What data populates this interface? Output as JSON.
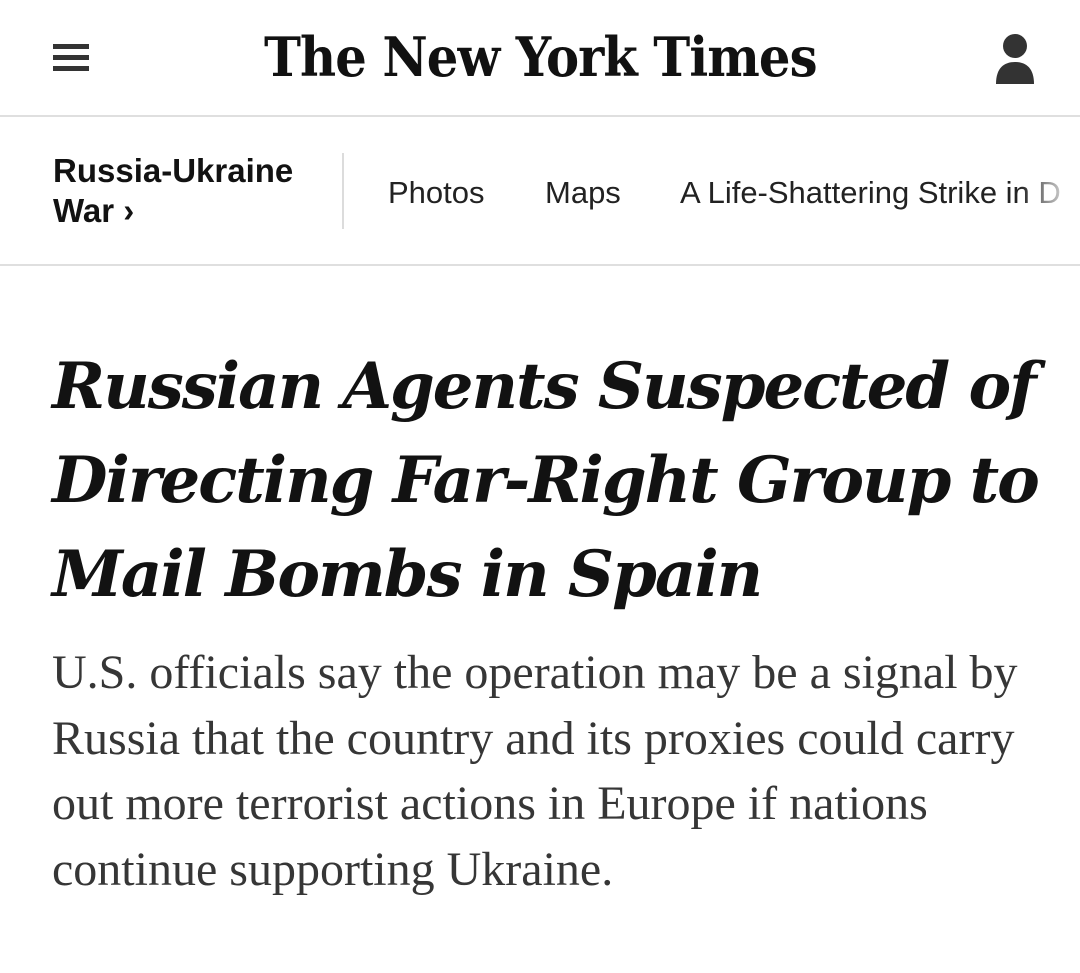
{
  "header": {
    "masthead": "The New York Times",
    "menu_icon": "hamburger-menu-icon",
    "account_icon": "account-icon"
  },
  "section": {
    "title": "Russia-Ukraine War",
    "title_line1": "Russia-Ukraine",
    "title_line2": "War",
    "chevron": "›",
    "links": [
      "Photos",
      "Maps",
      "A Life-Shattering Strike in D"
    ]
  },
  "article": {
    "headline": "Russian Agents Suspected of Directing Far-Right Group to Mail Bombs in Spain",
    "summary": "U.S. officials say the operation may be a signal by Russia that the country and its proxies could carry out more terrorist actions in Europe if nations continue supporting Ukraine."
  },
  "colors": {
    "text": "#121212",
    "summary_text": "#363636",
    "divider": "#dfdfdf"
  }
}
